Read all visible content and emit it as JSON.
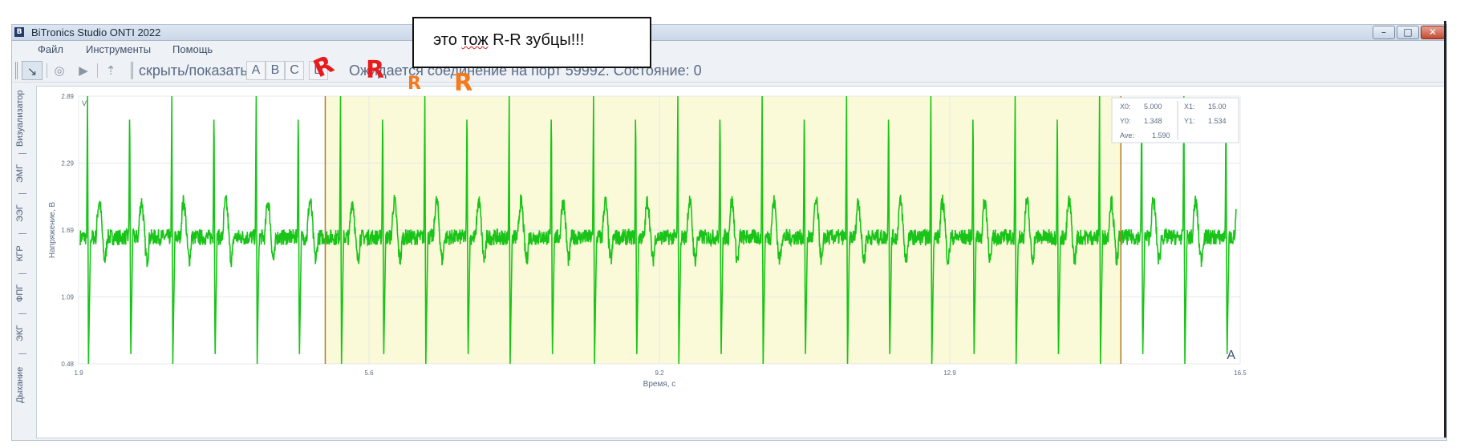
{
  "window": {
    "title": "BiTronics Studio ONTI 2022",
    "app_icon": "B",
    "buttons": {
      "minimize": "–",
      "maximize": "□",
      "close": "✕"
    }
  },
  "menu": [
    "Файл",
    "Инструменты",
    "Помощь"
  ],
  "toolbar": {
    "icons": [
      "pointer-icon",
      "record-icon",
      "play-icon",
      "marker-icon"
    ],
    "hide_label": "скрыть/показать:",
    "channels": [
      "A",
      "B",
      "C",
      "D"
    ],
    "status": "Ожидается соединение на порт 59992. Состояние: 0"
  },
  "side_tabs": [
    "Визуализатор",
    "ЭМГ",
    "ЭЭГ",
    "КГР",
    "ФПГ",
    "ЭКГ",
    "Дыхание"
  ],
  "annotation": {
    "text_before": "это ",
    "text_underlined": "тож",
    "text_after": " R-R зубцы!!!",
    "marks_red": [
      "R",
      "R"
    ],
    "marks_orange": [
      "R",
      "R"
    ],
    "color_red": "#e81c1c",
    "color_orange": "#f47a1c"
  },
  "chart_data": {
    "type": "line",
    "title": "",
    "xlabel": "Время, с",
    "ylabel": "Напряжение, В",
    "xlim": [
      1.9,
      16.5
    ],
    "ylim": [
      0.48,
      2.89
    ],
    "x_ticks": [
      "1.9",
      "5.6",
      "9.2",
      "12.9",
      "16.5"
    ],
    "y_ticks": [
      "0.48",
      "1.09",
      "1.69",
      "2.29",
      "2.89"
    ],
    "grid": true,
    "channel_label": "A",
    "corner_label": "V",
    "line_color": "#18c418",
    "selection": {
      "x_start": 5.0,
      "x_end": 15.0,
      "fill": "#fbfad8",
      "edge_color": "#b07a2a"
    },
    "readout": {
      "x0_label": "X0:",
      "x0": "5.000",
      "x1_label": "X1:",
      "x1": "15.00",
      "y0_label": "Y0:",
      "y0": "1.348",
      "y1_label": "Y1:",
      "y1": "1.534",
      "ave_label": "Ave:",
      "ave": "1.590"
    },
    "beats": {
      "start": 2.0,
      "period": 0.53,
      "r_peak": 2.89,
      "s_trough": 0.48,
      "baseline": 1.62,
      "noise": 0.09
    },
    "series": [
      {
        "values_description": "ECG trace"
      }
    ]
  }
}
